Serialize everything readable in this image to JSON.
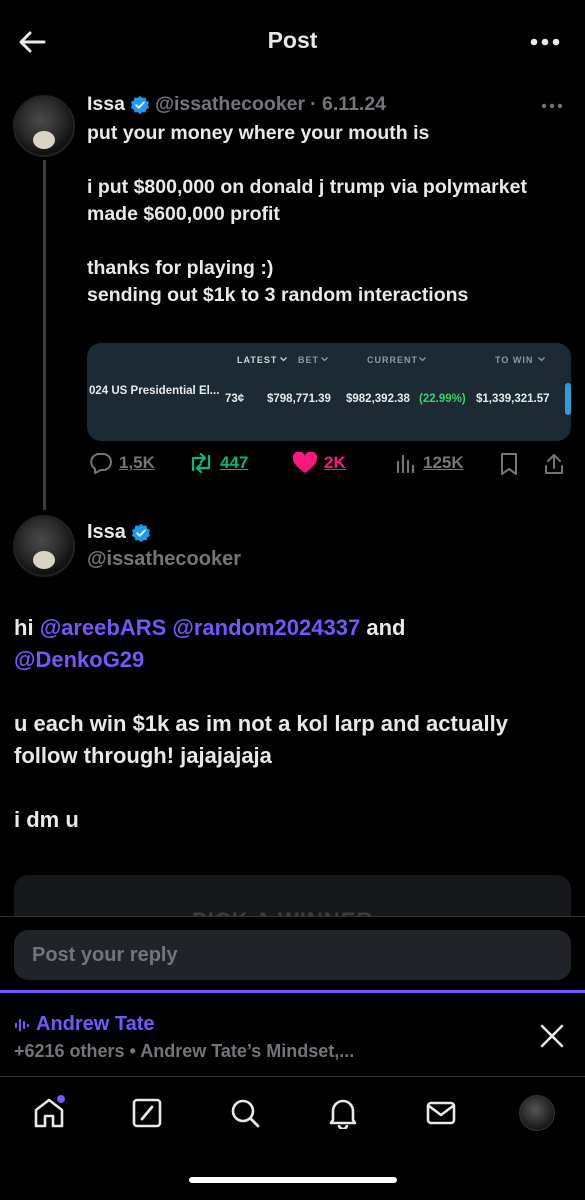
{
  "header": {
    "title": "Post"
  },
  "tweet1": {
    "name": "Issa",
    "handle": "@issathecooker",
    "date": "· 6.11.24",
    "lines": "put your money where your mouth is\n\ni put $800,000 on donald j trump via polymarket\nmade $600,000 profit\n\nthanks for playing :)\nsending out $1k to 3 random interactions",
    "embed": {
      "headers": {
        "latest": "LATEST",
        "bet": "BET",
        "current": "CURRENT",
        "to_win": "TO WIN"
      },
      "market": "024 US Presidential El...",
      "price": "73¢",
      "bet": "$798,771.39",
      "current": "$982,392.38",
      "change": "(22.99%)",
      "to_win": "$1,339,321.57"
    },
    "stats": {
      "replies": "1,5K",
      "reposts": "447",
      "likes": "2K",
      "views": "125K"
    },
    "colors": {
      "repost": "#00ba7c",
      "like": "#f91880"
    }
  },
  "tweet2": {
    "name": "Issa",
    "handle": "@issathecooker",
    "greeting": "hi",
    "mention1": "@areebARS",
    "mention2": "@random2024337",
    "and": "and",
    "mention3": "@DenkoG29",
    "para2": "u each win $1k as im not a kol larp and actually follow through!  jajajajaja",
    "para3": "i dm u",
    "card_text": "PICK A WINNER"
  },
  "reply": {
    "placeholder": "Post your reply"
  },
  "spaces": {
    "host": "Andrew Tate",
    "subtitle": "+6216 others • Andrew Tate’s Mindset,..."
  },
  "nav": {
    "items": [
      "home-icon",
      "compose-icon",
      "search-icon",
      "notifications-icon",
      "messages-icon",
      "profile-avatar"
    ]
  },
  "colors": {
    "accent": "#7856ff",
    "verified": "#1d9bf0"
  }
}
